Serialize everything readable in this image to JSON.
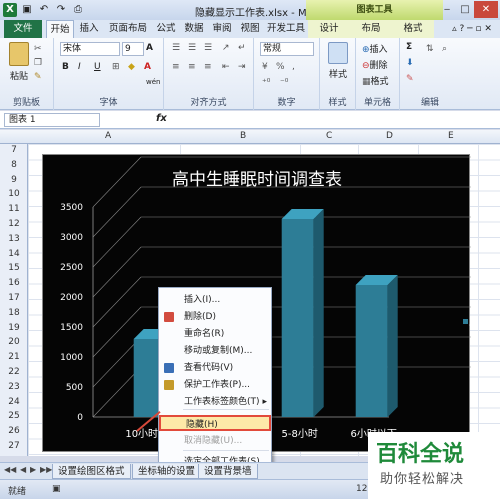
{
  "window": {
    "title": "隐藏显示工作表.xlsx - Microsoft Excel",
    "context_tool": "图表工具"
  },
  "tabs": [
    "文件",
    "开始",
    "插入",
    "页面布局",
    "公式",
    "数据",
    "审阅",
    "视图",
    "开发工具",
    "设计",
    "布局",
    "格式"
  ],
  "ribbon": {
    "clipboard": {
      "paste": "粘贴",
      "label": "剪贴板"
    },
    "font": {
      "name": "宋体",
      "size": "9",
      "bold": "B",
      "italic": "I",
      "underline": "U",
      "grow": "A",
      "wen": "wén",
      "label": "字体"
    },
    "alignment": {
      "label": "对齐方式"
    },
    "number": {
      "format": "常规",
      "label": "数字"
    },
    "styles": {
      "style": "样式",
      "label": "样式"
    },
    "cells": {
      "insert": "插入",
      "delete": "删除",
      "format": "格式",
      "label": "单元格"
    },
    "editing": {
      "sigma": "Σ",
      "label": "编辑"
    }
  },
  "formula_bar": {
    "name_box": "图表 1",
    "fx": "fx"
  },
  "columns": [
    "A",
    "B",
    "C",
    "D",
    "E"
  ],
  "rows": [
    "7",
    "8",
    "9",
    "10",
    "11",
    "12",
    "13",
    "14",
    "15",
    "16",
    "17",
    "18",
    "19",
    "20",
    "21",
    "22",
    "23",
    "24",
    "25",
    "26",
    "27"
  ],
  "chart_data": {
    "type": "bar",
    "title": "高中生睡眠时间调查表",
    "categories": [
      "10小时以上",
      "",
      "5-8小时",
      "6小时以下"
    ],
    "values": [
      1300,
      0,
      3300,
      2200
    ],
    "y_ticks": [
      "0",
      "500",
      "1000",
      "1500",
      "2000",
      "2500",
      "3000",
      "3500"
    ],
    "ylim": [
      0,
      3500
    ],
    "legend_fragment": "人",
    "bar_color": "#2d7d96",
    "bar_top_color": "#3ea2c0",
    "bar_side_color": "#1e5a6d",
    "background": "#050505"
  },
  "context_menu": {
    "items": [
      {
        "label": "插入(I)...",
        "icon": ""
      },
      {
        "label": "删除(D)",
        "icon": "delete-sheet-icon"
      },
      {
        "label": "重命名(R)",
        "icon": ""
      },
      {
        "label": "移动或复制(M)...",
        "icon": ""
      },
      {
        "label": "查看代码(V)",
        "icon": "view-code-icon"
      },
      {
        "label": "保护工作表(P)...",
        "icon": "protect-sheet-icon"
      },
      {
        "label": "工作表标签颜色(T)",
        "icon": ""
      },
      {
        "label": "隐藏(H)",
        "icon": ""
      },
      {
        "label": "取消隐藏(U)...",
        "icon": ""
      },
      {
        "label": "选定全部工作表(S)",
        "icon": ""
      }
    ]
  },
  "sheet_tabs": [
    "设置绘图区格式",
    "坐标轴的设置",
    "设置背景墙"
  ],
  "status": {
    "ready": "就绪",
    "zoom": "120"
  },
  "watermark": {
    "top": "百科全说",
    "bottom": "助你轻松解决"
  }
}
